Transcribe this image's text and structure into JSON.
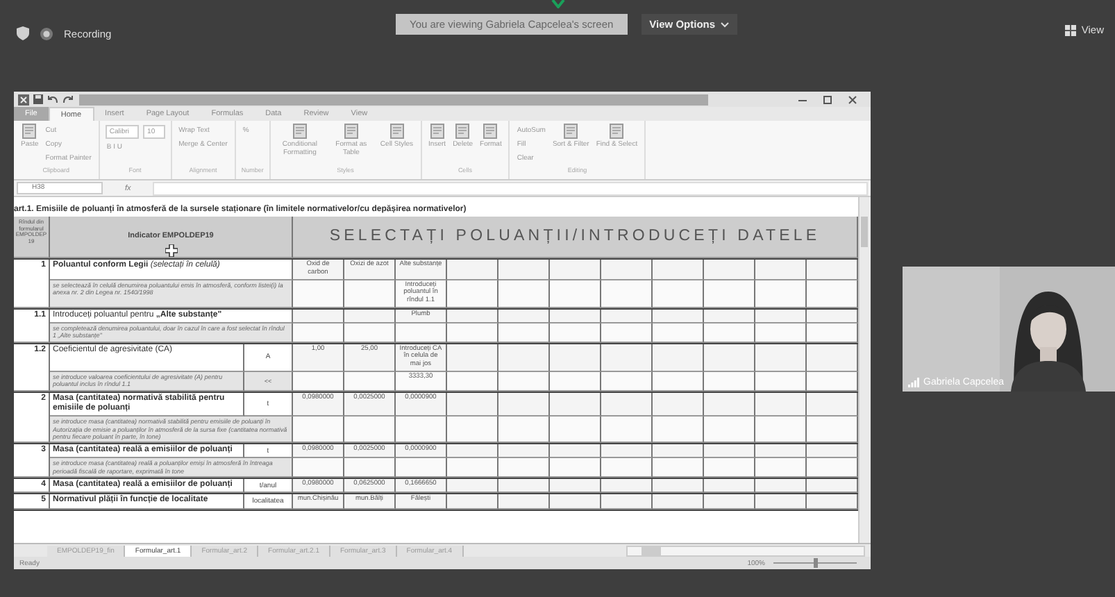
{
  "meeting": {
    "recording": "Recording",
    "banner": "You are viewing Gabriela Capcelea's screen",
    "view_options": "View Options",
    "view": "View"
  },
  "excel": {
    "tabs": [
      {
        "label": "File",
        "selected": false,
        "kind": "file"
      },
      {
        "label": "Home",
        "selected": true,
        "kind": "tab"
      },
      {
        "label": "Insert",
        "selected": false,
        "kind": "tab"
      },
      {
        "label": "Page Layout",
        "selected": false,
        "kind": "tab"
      },
      {
        "label": "Formulas",
        "selected": false,
        "kind": "tab"
      },
      {
        "label": "Data",
        "selected": false,
        "kind": "tab"
      },
      {
        "label": "Review",
        "selected": false,
        "kind": "tab"
      },
      {
        "label": "View",
        "selected": false,
        "kind": "tab"
      }
    ],
    "groups": [
      {
        "name": "Clipboard",
        "items": [
          {
            "label": "Paste",
            "kind": "large"
          },
          {
            "label": "Cut",
            "kind": "small"
          },
          {
            "label": "Copy",
            "kind": "small"
          },
          {
            "label": "Format Painter",
            "kind": "small"
          }
        ]
      },
      {
        "name": "Font",
        "items": [
          {
            "label": "Calibri",
            "kind": "field"
          },
          {
            "label": "B  I  U",
            "kind": "small"
          },
          {
            "label": "10",
            "kind": "field"
          }
        ]
      },
      {
        "name": "Alignment",
        "items": [
          {
            "label": "Wrap Text",
            "kind": "small"
          },
          {
            "label": "Merge & Center",
            "kind": "small"
          }
        ]
      },
      {
        "name": "Number",
        "items": [
          {
            "label": "%",
            "kind": "small"
          }
        ]
      },
      {
        "name": "Styles",
        "items": [
          {
            "label": "Conditional Formatting",
            "kind": "large"
          },
          {
            "label": "Format as Table",
            "kind": "large"
          },
          {
            "label": "Cell Styles",
            "kind": "large"
          }
        ]
      },
      {
        "name": "Cells",
        "items": [
          {
            "label": "Insert",
            "kind": "large"
          },
          {
            "label": "Delete",
            "kind": "large"
          },
          {
            "label": "Format",
            "kind": "large"
          }
        ]
      },
      {
        "name": "Editing",
        "items": [
          {
            "label": "AutoSum",
            "kind": "small"
          },
          {
            "label": "Fill",
            "kind": "small"
          },
          {
            "label": "Clear",
            "kind": "small"
          },
          {
            "label": "Sort & Filter",
            "kind": "large"
          },
          {
            "label": "Find & Select",
            "kind": "large"
          }
        ]
      }
    ],
    "formula": {
      "name_box": "H38",
      "fx": "fx"
    },
    "sheet": {
      "title": "art.1. Emisiile de poluanți în atmosferă de la sursele staționare (în limitele normativelor/cu depășirea normativelor)",
      "header": {
        "num": "Rîndul din formularul EMPOLDEP 19",
        "indicator": "Indicator EMPOLDEP19",
        "data": "SELECTAȚI POLUANȚII/INTRODUCEȚI DATELE"
      },
      "rows": [
        {
          "num": "1",
          "label": "**Poluantul conform Legii** *(selectați în celulă)*",
          "values": [
            "Oxid de carbon",
            "Oxizi de azot",
            "Alte substanțe"
          ],
          "note": "se selectează în celulă denumirea poluantului emis în atmosferă, conform listei(i) la anexa nr. 2 din Legea nr. 1540/1998",
          "note_value": "Introduceți poluantul în rîndul 1.1"
        },
        {
          "num": "1.1",
          "label": "Introduceți poluantul pentru **„Alte substanțe\"**",
          "column_3": "Plumb",
          "note": "se completează denumirea poluantului, doar în cazul în care a fost selectat în rîndul 1 „Alte substanțe\""
        },
        {
          "num": "1.2",
          "label": "Coeficientul de agresivitate (CA)",
          "unit": "A",
          "values": [
            "1,00",
            "25,00",
            "Introduceți CA în celula de mai jos"
          ],
          "note": "se introduce valoarea coeficientului de agresivitate (A) pentru poluantul inclus în rîndul 1.1",
          "note_unit": "<<",
          "note_value": "3333,30"
        },
        {
          "num": "2",
          "label": "**Masa (cantitatea) normativă stabilită pentru emisiile de poluanți**",
          "unit": "t",
          "values": [
            "0,0980000",
            "0,0025000",
            "0,0000900"
          ],
          "note": "se introduce masa (cantitatea) normativă stabilită pentru emisiile de poluanți în Autorizația de emisie a poluanților în atmosferă de la sursa fixe (cantitatea normativă pentru fiecare poluant în parte, în tone)"
        },
        {
          "num": "3",
          "label": "**Masa (cantitatea) reală a emisiilor de poluanți**",
          "unit": "t",
          "values": [
            "0,0980000",
            "0,0025000",
            "0,0000900"
          ],
          "note": "se introduce masa (cantitatea) reală a poluanților emiși în atmosferă în întreaga perioadă fiscală de raportare, exprimată în tone"
        },
        {
          "num": "4",
          "label": "**Masa (cantitatea) reală a emisiilor de poluanți**",
          "unit": "t/anul",
          "values": [
            "0,0980000",
            "0,0625000",
            "0,1666650"
          ]
        },
        {
          "num": "5",
          "label": "**Normativul plății în funcție de localitate**",
          "unit": "localitatea",
          "values": [
            "mun.Chișinău",
            "mun.Bălți",
            "Fălești"
          ]
        }
      ]
    },
    "sheet_tabs": [
      {
        "label": "EMPOLDEP19_fin",
        "selected": false
      },
      {
        "label": "Formular_art.1",
        "selected": true
      },
      {
        "label": "Formular_art.2",
        "selected": false
      },
      {
        "label": "Formular_art.2.1",
        "selected": false
      },
      {
        "label": "Formular_art.3",
        "selected": false
      },
      {
        "label": "Formular_art.4",
        "selected": false
      }
    ],
    "status": "Ready",
    "zoom": "100%",
    "zoom_slider": {
      "level": 0.5
    }
  },
  "video": {
    "name": "Gabriela Capcelea"
  }
}
